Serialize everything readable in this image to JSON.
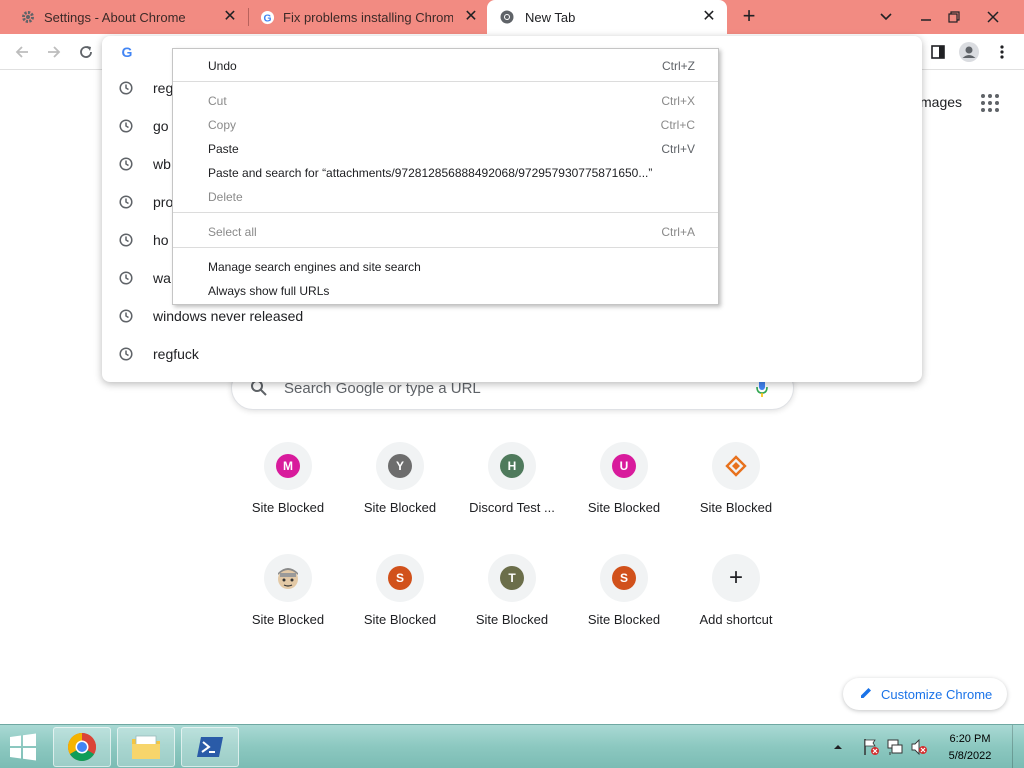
{
  "tabs": [
    {
      "title": "Settings - About Chrome",
      "favicon": "gear-icon"
    },
    {
      "title": "Fix problems installing Chrome -",
      "favicon": "google-g-icon"
    },
    {
      "title": "New Tab",
      "favicon": "chrome-icon"
    }
  ],
  "new_tab_symbol": "+",
  "window_controls": {
    "tab_search": "⌄",
    "minimize": "—",
    "maximize": "❐",
    "close": "✕"
  },
  "omnibox": {
    "engine_logo": "G",
    "suggestions": [
      {
        "text": "reg",
        "icon": "history-clock-icon"
      },
      {
        "text": "go",
        "icon": "history-clock-icon"
      },
      {
        "text": "wb",
        "icon": "history-clock-icon"
      },
      {
        "text": "pro",
        "icon": "history-clock-icon"
      },
      {
        "text": "ho",
        "icon": "history-clock-icon"
      },
      {
        "text": "wa",
        "icon": "history-clock-icon"
      },
      {
        "text": "windows never released",
        "icon": "history-clock-icon"
      },
      {
        "text": "regfuck",
        "icon": "history-clock-icon"
      }
    ]
  },
  "context_menu": {
    "items": [
      {
        "label": "Undo",
        "shortcut": "Ctrl+Z"
      },
      {
        "label": "Cut",
        "shortcut": "Ctrl+X"
      },
      {
        "label": "Copy",
        "shortcut": "Ctrl+C"
      },
      {
        "label": "Paste",
        "shortcut": "Ctrl+V"
      },
      {
        "label": "Paste and search for “attachments/972812856888492068/972957930775871650...”",
        "shortcut": ""
      },
      {
        "label": "Delete",
        "shortcut": ""
      },
      {
        "label": "Select all",
        "shortcut": "Ctrl+A"
      },
      {
        "label": "Manage search engines and site search",
        "shortcut": ""
      },
      {
        "label": "Always show full URLs",
        "shortcut": ""
      }
    ]
  },
  "ntp": {
    "images_link": "mages",
    "search_placeholder": "Search Google or type a URL",
    "shortcuts": [
      {
        "label": "Site Blocked",
        "letter": "M",
        "color": "#d81b9c"
      },
      {
        "label": "Site Blocked",
        "letter": "Y",
        "color": "#6d6d6d"
      },
      {
        "label": "Discord Test ...",
        "letter": "H",
        "color": "#4f7a5c"
      },
      {
        "label": "Site Blocked",
        "letter": "U",
        "color": "#d81b9c"
      },
      {
        "label": "Site Blocked",
        "letter": "",
        "color": "#e8711c"
      },
      {
        "label": "Site Blocked",
        "letter": "",
        "color": "#a0a0a0"
      },
      {
        "label": "Site Blocked",
        "letter": "S",
        "color": "#d1511b"
      },
      {
        "label": "Site Blocked",
        "letter": "T",
        "color": "#6b6e4a"
      },
      {
        "label": "Site Blocked",
        "letter": "S",
        "color": "#d1511b"
      },
      {
        "label": "Add shortcut",
        "letter": "+",
        "color": "#202124"
      }
    ],
    "customize_label": "Customize Chrome"
  },
  "taskbar": {
    "time": "6:20 PM",
    "date": "5/8/2022"
  },
  "colors": {
    "tabstrip": "#f28b82",
    "accent": "#1a73e8",
    "taskbar": "#8cc8c0"
  }
}
